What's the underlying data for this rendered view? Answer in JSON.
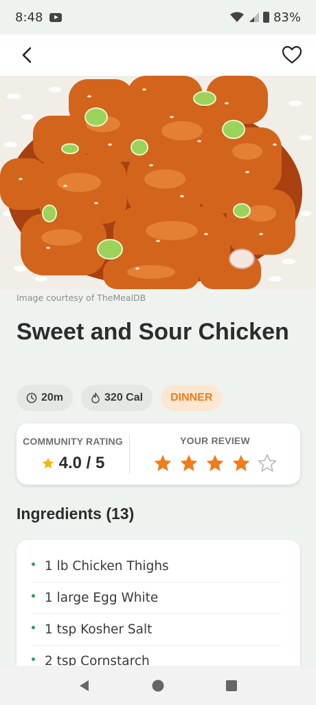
{
  "status_bar": {
    "time": "8:48",
    "battery": "83%"
  },
  "app_bar": {
    "back_icon": "chevron-left-icon",
    "favorite_icon": "heart-outline-icon"
  },
  "hero": {
    "description_icon": "food-photo"
  },
  "caption": "Image courtesy of TheMealDB",
  "recipe": {
    "title": "Sweet and Sour Chicken",
    "time": "20m",
    "calories": "320 Cal",
    "category": "DINNER"
  },
  "rating": {
    "community_label": "COMMUNITY RATING",
    "community_value": "4.0 / 5",
    "review_label": "YOUR REVIEW",
    "user_stars": 4,
    "max_stars": 5
  },
  "ingredients": {
    "heading": "Ingredients (13)",
    "items": [
      "1 lb Chicken Thighs",
      "1 large Egg White",
      "1 tsp Kosher Salt",
      "2 tsp Cornstarch"
    ]
  },
  "colors": {
    "accent": "#f07d1a",
    "star_gold": "#f5b800",
    "bullet": "#2e9e5b"
  }
}
